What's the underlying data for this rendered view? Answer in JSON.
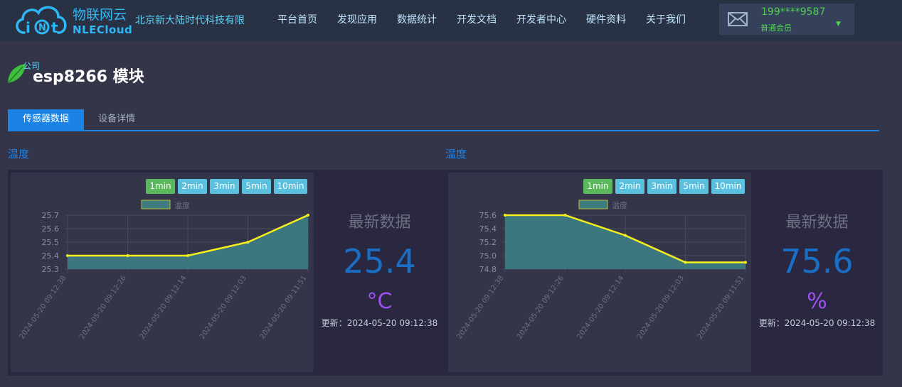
{
  "header": {
    "logo_cn": "物联网云",
    "logo_en": "NLECloud",
    "company": "北京新大陆时代科技有限",
    "nav": [
      "平台首页",
      "发现应用",
      "数据统计",
      "开发文档",
      "开发者中心",
      "硬件资料",
      "关于我们"
    ],
    "user": {
      "phone": "199****9587",
      "role": "普通会员"
    }
  },
  "page": {
    "badge": "公司",
    "title": "esp8266 模块"
  },
  "tabs": [
    {
      "label": "传感器数据",
      "active": true
    },
    {
      "label": "设备详情",
      "active": false
    }
  ],
  "colors": {
    "accent": "#1b82e6",
    "line": "#f5f01c",
    "area": "#3d7a82",
    "btn_selected": "#5cb85c",
    "btn": "#5bc0de",
    "value": "#1a6ec4",
    "unit": "#a04ff5"
  },
  "sensors": [
    {
      "title": "温度",
      "latest_label": "最新数据",
      "latest_value": "25.4",
      "unit": "°C",
      "update": "更新：2024-05-20 09:12:38",
      "range_buttons": [
        "1min",
        "2min",
        "3min",
        "5min",
        "10min"
      ],
      "selected_range": "1min",
      "chart_data": {
        "type": "area",
        "legend": [
          "温度"
        ],
        "legend_position": "top-center",
        "x": [
          "2024-05-20 09:12:38",
          "2024-05-20 09:12:26",
          "2024-05-20 09:12:14",
          "2024-05-20 09:12:03",
          "2024-05-20 09:11:51"
        ],
        "series": [
          {
            "name": "温度",
            "values": [
              25.4,
              25.4,
              25.4,
              25.5,
              25.7
            ]
          }
        ],
        "yticks": [
          "25.3",
          "25.4",
          "25.5",
          "25.6",
          "25.7"
        ],
        "ylim": [
          25.3,
          25.7
        ],
        "grid": true
      }
    },
    {
      "title": "温度",
      "latest_label": "最新数据",
      "latest_value": "75.6",
      "unit": "%",
      "update": "更新：2024-05-20 09:12:38",
      "range_buttons": [
        "1min",
        "2min",
        "3min",
        "5min",
        "10min"
      ],
      "selected_range": "1min",
      "chart_data": {
        "type": "area",
        "legend": [
          "温度"
        ],
        "legend_position": "top-center",
        "x": [
          "2024-05-20 09:12:38",
          "2024-05-20 09:12:26",
          "2024-05-20 09:12:14",
          "2024-05-20 09:12:03",
          "2024-05-20 09:11:51"
        ],
        "series": [
          {
            "name": "温度",
            "values": [
              75.6,
              75.6,
              75.3,
              74.9,
              74.9
            ]
          }
        ],
        "yticks": [
          "74.8",
          "75.0",
          "75.2",
          "75.4",
          "75.6"
        ],
        "ylim": [
          74.8,
          75.6
        ],
        "grid": true
      }
    }
  ]
}
